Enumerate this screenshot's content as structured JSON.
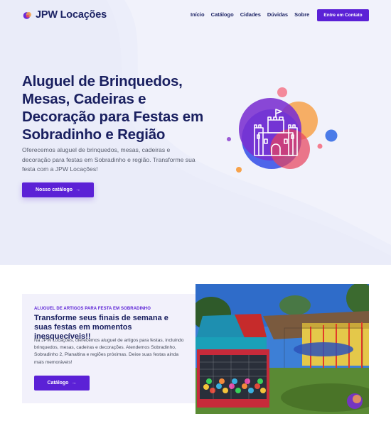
{
  "brand": {
    "name": "JPW Locações"
  },
  "nav": {
    "links": [
      "Início",
      "Catálogo",
      "Cidades",
      "Dúvidas",
      "Sobre"
    ],
    "cta": "Entre em Contato"
  },
  "hero": {
    "title": "Aluguel de Brinquedos, Mesas, Cadeiras e Decoração para Festas em Sobradinho e Região",
    "subtitle": "Oferecemos aluguel de brinquedos, mesas, cadeiras e decoração para festas em Sobradinho e região. Transforme sua festa com a JPW Locações!",
    "button": "Nosso catálogo",
    "button_icon": "arrow-right-icon"
  },
  "feature": {
    "eyebrow": "ALUGUEL DE ARTIGOS PARA FESTA EM SOBRADINHO",
    "title": "Transforme seus finais de semana e suas festas em momentos inesquecíveis!!",
    "text": "Na JPW Locações, oferecemos aluguel de artigos para festas, incluindo brinquedos, mesas, cadeiras e decorações. Atendemos Sobradinho, Sobradinho 2, Planaltina e regiões próximas. Deixe suas festas ainda mais memoráveis!",
    "button": "Catálogo",
    "button_icon": "arrow-right-icon"
  },
  "colors": {
    "primary": "#5b21d6",
    "heading": "#1a2060",
    "hero_bg": "#f1f2fb"
  }
}
